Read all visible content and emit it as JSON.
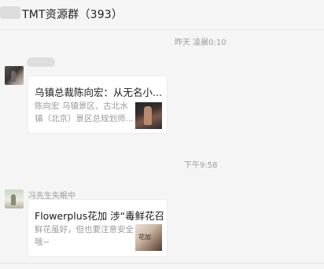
{
  "header": {
    "title": "TMT资源群（393）"
  },
  "messages": [
    {
      "timestamp": "昨天 凌晨0:10",
      "sender": "",
      "card": {
        "title": "乌镇总裁陈向宏：从无名小...",
        "desc_line1": "陈向宏 乌镇景区、古北水",
        "desc_line2": "镇（北京）景区总规划师..."
      }
    },
    {
      "timestamp": "下午9:58",
      "sender": "冯先生失眠中",
      "card": {
        "title": "Flowerplus花加 涉“毒鲜花召...",
        "desc_line1": "鲜花虽好，但也要注意安全",
        "desc_line2": "哦~",
        "thumb_text": "花加"
      }
    }
  ]
}
